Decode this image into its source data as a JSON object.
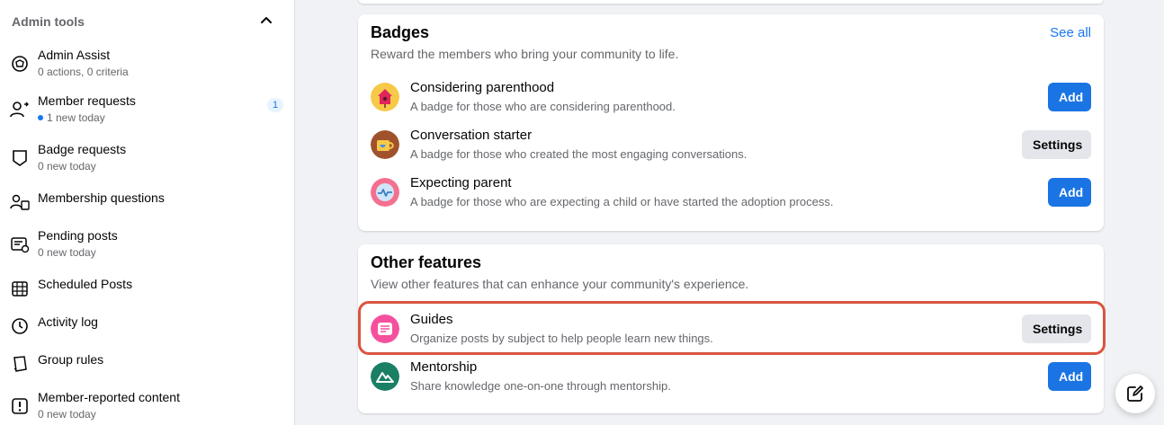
{
  "sidebar": {
    "title": "Admin tools",
    "items": [
      {
        "label": "Admin Assist",
        "sub": "0 actions, 0 criteria",
        "icon": "admin-assist-icon"
      },
      {
        "label": "Member requests",
        "sub": "1 new today",
        "badge": "1",
        "icon": "member-requests-icon"
      },
      {
        "label": "Badge requests",
        "sub": "0 new today",
        "icon": "badge-icon"
      },
      {
        "label": "Membership questions",
        "icon": "questions-icon"
      },
      {
        "label": "Pending posts",
        "sub": "0 new today",
        "icon": "pending-posts-icon"
      },
      {
        "label": "Scheduled Posts",
        "icon": "calendar-icon"
      },
      {
        "label": "Activity log",
        "icon": "clock-icon"
      },
      {
        "label": "Group rules",
        "icon": "rules-icon"
      },
      {
        "label": "Member-reported content",
        "sub": "0 new today",
        "icon": "alert-icon"
      }
    ]
  },
  "badges": {
    "title": "Badges",
    "description": "Reward the members who bring your community to life.",
    "see_all": "See all",
    "rows": [
      {
        "name": "Considering parenthood",
        "desc": "A badge for those who are considering parenthood.",
        "button": "Add",
        "icon": "birdhouse-icon"
      },
      {
        "name": "Conversation starter",
        "desc": "A badge for those who created the most engaging conversations.",
        "button": "Settings",
        "icon": "coffee-mug-icon"
      },
      {
        "name": "Expecting parent",
        "desc": "A badge for those who are expecting a child or have started the adoption process.",
        "button": "Add",
        "icon": "heartbeat-icon"
      }
    ]
  },
  "other": {
    "title": "Other features",
    "description": "View other features that can enhance your community's experience.",
    "rows": [
      {
        "name": "Guides",
        "desc": "Organize posts by subject to help people learn new things.",
        "button": "Settings",
        "icon": "guides-icon"
      },
      {
        "name": "Mentorship",
        "desc": "Share knowledge one-on-one through mentorship.",
        "button": "Add",
        "icon": "mentorship-icon"
      }
    ]
  },
  "colors": {
    "accent": "#1877f2",
    "add_button": "#1b74e4",
    "highlight": "#d9553f"
  }
}
